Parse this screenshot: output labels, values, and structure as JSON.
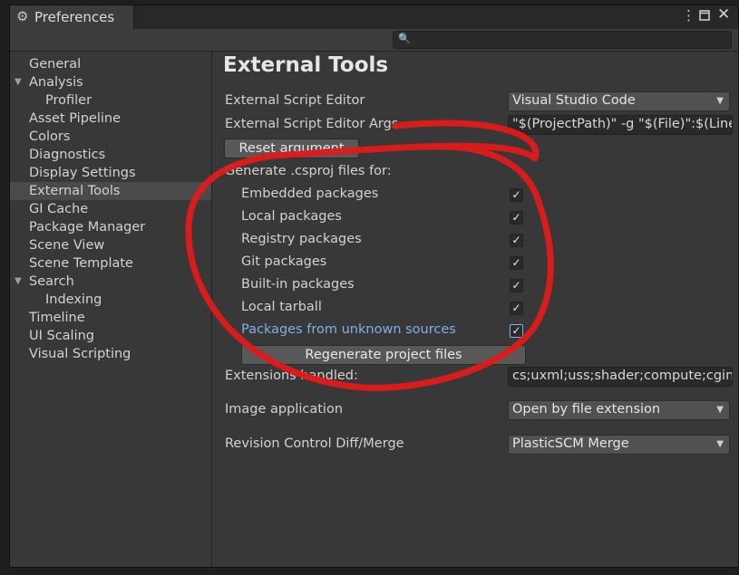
{
  "window": {
    "tab_title": "Preferences",
    "search": {
      "value": "",
      "placeholder": ""
    }
  },
  "sidebar": {
    "items": [
      {
        "label": "General",
        "indent": 0,
        "expandable": false,
        "selected": false
      },
      {
        "label": "Analysis",
        "indent": 0,
        "expandable": true,
        "selected": false
      },
      {
        "label": "Profiler",
        "indent": 1,
        "expandable": false,
        "selected": false
      },
      {
        "label": "Asset Pipeline",
        "indent": 0,
        "expandable": false,
        "selected": false
      },
      {
        "label": "Colors",
        "indent": 0,
        "expandable": false,
        "selected": false
      },
      {
        "label": "Diagnostics",
        "indent": 0,
        "expandable": false,
        "selected": false
      },
      {
        "label": "Display Settings",
        "indent": 0,
        "expandable": false,
        "selected": false
      },
      {
        "label": "External Tools",
        "indent": 0,
        "expandable": false,
        "selected": true
      },
      {
        "label": "GI Cache",
        "indent": 0,
        "expandable": false,
        "selected": false
      },
      {
        "label": "Package Manager",
        "indent": 0,
        "expandable": false,
        "selected": false
      },
      {
        "label": "Scene View",
        "indent": 0,
        "expandable": false,
        "selected": false
      },
      {
        "label": "Scene Template",
        "indent": 0,
        "expandable": false,
        "selected": false
      },
      {
        "label": "Search",
        "indent": 0,
        "expandable": true,
        "selected": false
      },
      {
        "label": "Indexing",
        "indent": 1,
        "expandable": false,
        "selected": false
      },
      {
        "label": "Timeline",
        "indent": 0,
        "expandable": false,
        "selected": false
      },
      {
        "label": "UI Scaling",
        "indent": 0,
        "expandable": false,
        "selected": false
      },
      {
        "label": "Visual Scripting",
        "indent": 0,
        "expandable": false,
        "selected": false
      }
    ]
  },
  "main": {
    "heading": "External Tools",
    "script_editor": {
      "label": "External Script Editor",
      "value": "Visual Studio Code"
    },
    "script_editor_args": {
      "label": "External Script Editor Args",
      "value": "\"$(ProjectPath)\" -g \"$(File)\":$(Line):$(Column)"
    },
    "reset_button": "Reset argument",
    "csproj_heading": "Generate .csproj files for:",
    "csproj_options": [
      {
        "label": "Embedded packages",
        "checked": true
      },
      {
        "label": "Local packages",
        "checked": true
      },
      {
        "label": "Registry packages",
        "checked": true
      },
      {
        "label": "Git packages",
        "checked": true
      },
      {
        "label": "Built-in packages",
        "checked": true
      },
      {
        "label": "Local tarball",
        "checked": true
      },
      {
        "label": "Packages from unknown sources",
        "checked": true
      }
    ],
    "regenerate_button": "Regenerate project files",
    "extensions": {
      "label": "Extensions handled:",
      "value": "cs;uxml;uss;shader;compute;cginc;hlsl;glslinc;template;raytrace"
    },
    "image_app": {
      "label": "Image application",
      "value": "Open by file extension"
    },
    "diff_merge": {
      "label": "Revision Control Diff/Merge",
      "value": "PlasticSCM Merge"
    }
  },
  "colors": {
    "annotation": "#e01a1a",
    "link": "#7fb0e8",
    "selection": "#4a4a4a"
  },
  "icons": {
    "title": "gear-icon",
    "search": "search-icon",
    "menu": "kebab-menu-icon",
    "maximize": "maximize-icon",
    "close": "close-icon",
    "dropdown": "chevron-down-icon",
    "check": "checkmark-icon"
  }
}
